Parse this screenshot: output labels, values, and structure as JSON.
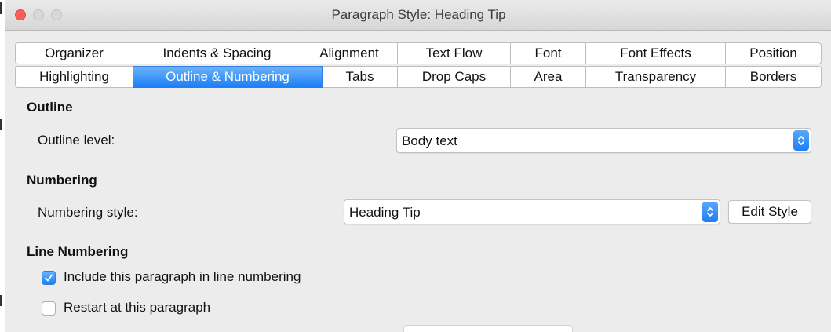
{
  "window": {
    "title": "Paragraph Style: Heading Tip",
    "buttons": [
      "close",
      "minimize",
      "zoom"
    ]
  },
  "tabs": {
    "row1": [
      "Organizer",
      "Indents & Spacing",
      "Alignment",
      "Text Flow",
      "Font",
      "Font Effects",
      "Position"
    ],
    "row2": [
      "Highlighting",
      "Outline & Numbering",
      "Tabs",
      "Drop Caps",
      "Area",
      "Transparency",
      "Borders"
    ],
    "active": "Outline & Numbering"
  },
  "outline": {
    "heading": "Outline",
    "level_label": "Outline level:",
    "level_value": "Body text"
  },
  "numbering": {
    "heading": "Numbering",
    "style_label": "Numbering style:",
    "style_value": "Heading Tip",
    "edit_style_label": "Edit Style"
  },
  "line_numbering": {
    "heading": "Line Numbering",
    "include_label": "Include this paragraph in line numbering",
    "include_checked": true,
    "restart_label": "Restart at this paragraph",
    "restart_checked": false
  },
  "colors": {
    "accent": "#1c7ef5",
    "close": "#fc605b",
    "window_bg": "#ececec"
  },
  "icons": {
    "combo_arrow": "updown-chevron-icon",
    "check": "checkmark-icon"
  }
}
